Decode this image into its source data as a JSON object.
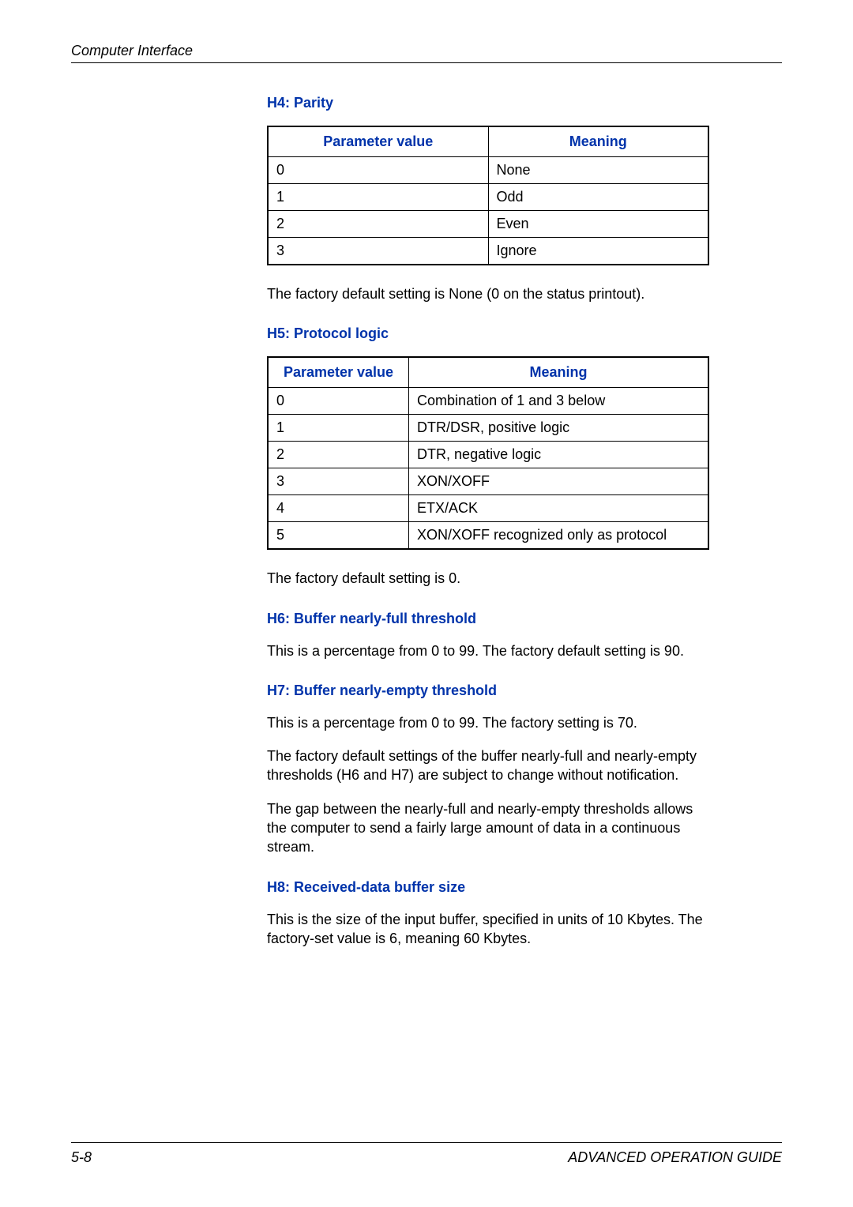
{
  "header": {
    "section_title": "Computer Interface"
  },
  "h4": {
    "title": "H4: Parity",
    "headers": {
      "param": "Parameter value",
      "meaning": "Meaning"
    },
    "rows": [
      {
        "param": "0",
        "meaning": "None"
      },
      {
        "param": "1",
        "meaning": "Odd"
      },
      {
        "param": "2",
        "meaning": "Even"
      },
      {
        "param": "3",
        "meaning": "Ignore"
      }
    ],
    "note": "The factory default setting is None (0 on the status printout)."
  },
  "h5": {
    "title": "H5: Protocol logic",
    "headers": {
      "param": "Parameter value",
      "meaning": "Meaning"
    },
    "rows": [
      {
        "param": "0",
        "meaning": "Combination of 1 and 3 below"
      },
      {
        "param": "1",
        "meaning": "DTR/DSR, positive logic"
      },
      {
        "param": "2",
        "meaning": "DTR, negative logic"
      },
      {
        "param": "3",
        "meaning": "XON/XOFF"
      },
      {
        "param": "4",
        "meaning": "ETX/ACK"
      },
      {
        "param": "5",
        "meaning": "XON/XOFF recognized only as protocol"
      }
    ],
    "note": "The factory default setting is 0."
  },
  "h6": {
    "title": "H6: Buffer nearly-full threshold",
    "note": "This is a percentage from 0 to 99. The factory default setting is 90."
  },
  "h7": {
    "title": "H7: Buffer nearly-empty threshold",
    "note1": "This is a percentage from 0 to 99. The factory setting is 70.",
    "note2": "The factory default settings of the buffer nearly-full and nearly-empty thresholds (H6 and H7) are subject to change without notification.",
    "note3": "The gap between the nearly-full and nearly-empty thresholds allows the computer to send a fairly large amount of data in a continuous stream."
  },
  "h8": {
    "title": "H8: Received-data buffer size",
    "note": "This is the size of the input buffer, specified in units of 10 Kbytes. The factory-set value is 6, meaning 60 Kbytes."
  },
  "footer": {
    "page_number": "5-8",
    "guide_title": "ADVANCED OPERATION GUIDE"
  }
}
